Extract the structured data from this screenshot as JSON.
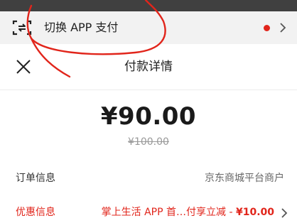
{
  "switch_bar": {
    "icon": "switch-scan-icon",
    "label": "切换 APP 支付",
    "dot_color": "#e1251b",
    "chevron": "chevron-right-icon"
  },
  "header": {
    "close_icon": "close-icon",
    "title": "付款详情"
  },
  "payment": {
    "amount": "¥90.00",
    "original_amount": "¥100.00"
  },
  "order_info": {
    "label": "订单信息",
    "value": "京东商城平台商户"
  },
  "discount_info": {
    "label": "优惠信息",
    "value_text": "掌上生活 APP 首…付享立减 - ",
    "value_amount": "¥10.00",
    "color": "#e1251b",
    "chevron": "chevron-right-icon"
  },
  "annotation": {
    "color": "#e1251b"
  }
}
